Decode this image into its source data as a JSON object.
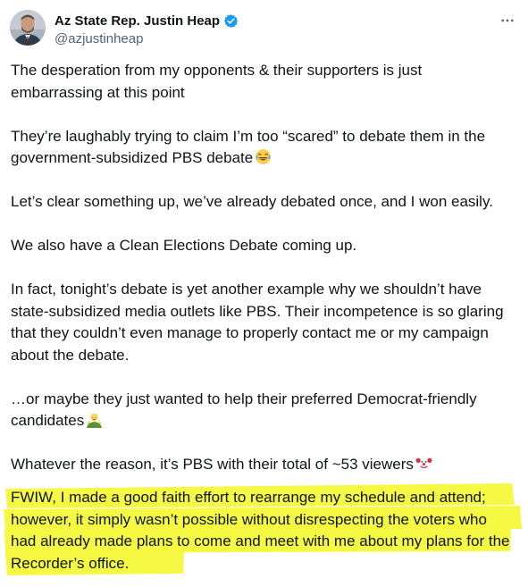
{
  "tweet": {
    "display_name": "Az State Rep. Justin Heap",
    "handle": "@azjustinheap",
    "avatar_icon": "profile-photo",
    "verified_icon": "verified-badge-icon",
    "more_icon": "more-options-icon",
    "paragraphs": [
      {
        "text": "The desperation from my opponents & their supporters is just embarrassing at this point"
      },
      {
        "text": "They’re laughably trying to claim I’m too “scared” to debate them in the government-subsidized PBS debate",
        "emoji": "laughing-tears-emoji"
      },
      {
        "text": "Let’s clear something up, we’ve already debated once, and I won easily."
      },
      {
        "text": "We also have a Clean Elections Debate coming up."
      },
      {
        "text": "In fact, tonight’s debate is yet another example why we shouldn’t have state-subsidized media outlets like PBS. Their incompetence is so glaring that they couldn’t even manage to properly contact me or my campaign about the debate."
      },
      {
        "text": "…or maybe they just wanted to help their preferred Democrat-friendly candidates",
        "emoji": "shrugging-man-emoji"
      },
      {
        "text": "Whatever the reason, it’s PBS with their total of ~53 viewers",
        "emoji": "clown-face-emoji"
      }
    ],
    "highlighted_paragraph": "FWIW, I made a good faith effort to rearrange my schedule and attend; however, it simply wasn’t possible without disrespecting the voters who had already made plans to come and meet with me about my plans for the Recorder’s office."
  },
  "colors": {
    "text": "#0f1419",
    "secondary_text": "#536471",
    "verified_blue": "#1d9bf0",
    "highlighter_yellow": "#f4f93a"
  }
}
